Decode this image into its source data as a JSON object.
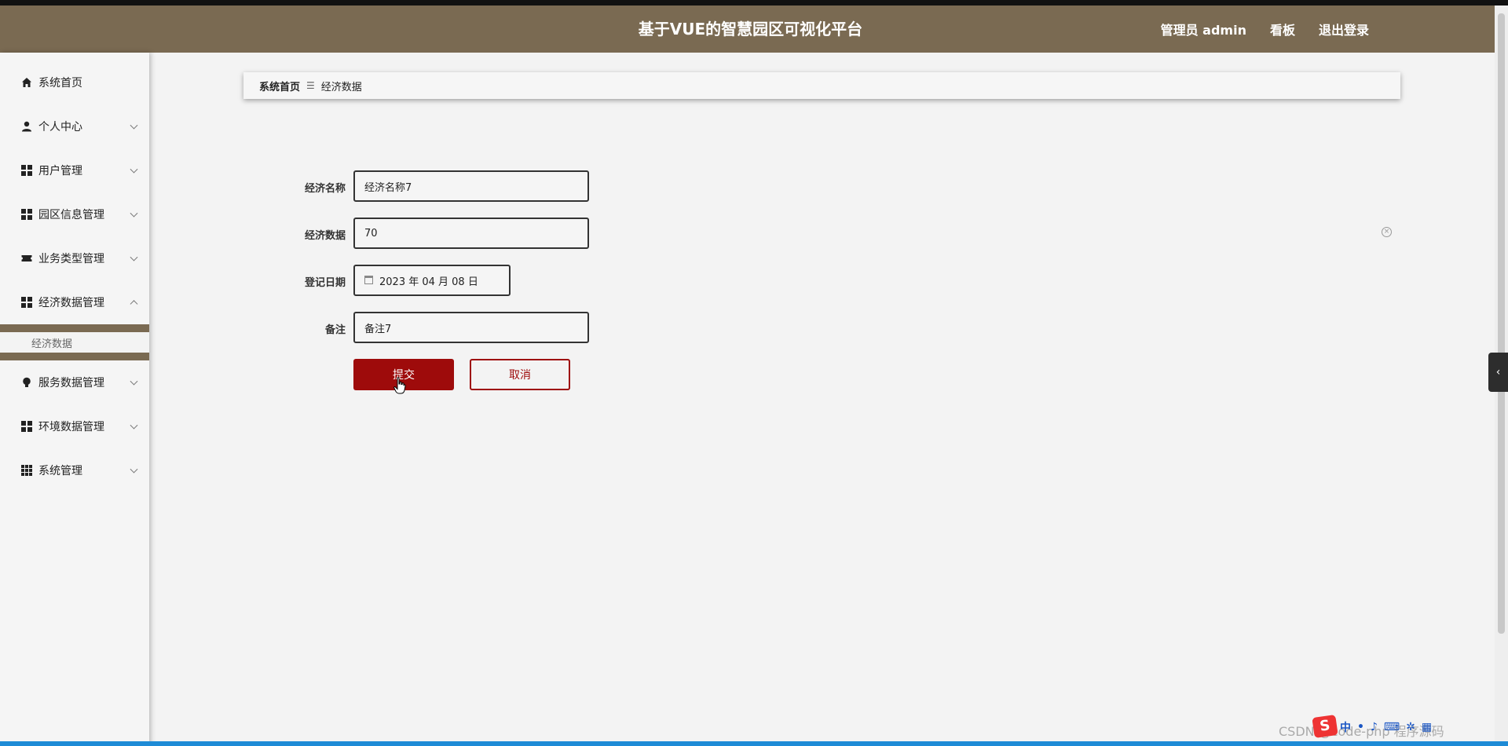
{
  "header": {
    "title": "基于VUE的智慧园区可视化平台",
    "admin_label": "管理员 admin",
    "dashboard_label": "看板",
    "logout_label": "退出登录"
  },
  "sidebar": {
    "items": [
      {
        "label": "系统首页",
        "icon": "home-icon"
      },
      {
        "label": "个人中心",
        "icon": "user-icon"
      },
      {
        "label": "用户管理",
        "icon": "grid-icon"
      },
      {
        "label": "园区信息管理",
        "icon": "grid-icon"
      },
      {
        "label": "业务类型管理",
        "icon": "ticket-icon"
      },
      {
        "label": "经济数据管理",
        "icon": "grid-icon",
        "expanded": true,
        "children": [
          "经济数据"
        ]
      },
      {
        "label": "服务数据管理",
        "icon": "bulb-icon"
      },
      {
        "label": "环境数据管理",
        "icon": "grid-icon"
      },
      {
        "label": "系统管理",
        "icon": "apps-icon"
      }
    ]
  },
  "breadcrumb": {
    "home": "系统首页",
    "separator": "☰",
    "current": "经济数据"
  },
  "form": {
    "name_label": "经济名称",
    "name_value": "经济名称7",
    "data_label": "经济数据",
    "data_value": "70",
    "date_label": "登记日期",
    "date_value": "2023 年 04 月 08 日",
    "remark_label": "备注",
    "remark_value": "备注7",
    "submit_label": "提交",
    "cancel_label": "取消"
  },
  "colors": {
    "header": "#7a6a52",
    "primary": "#9e0b0b"
  },
  "watermark": "CSDN @code-php 程序源码",
  "tray": {
    "logo": "S",
    "ime": "中"
  }
}
